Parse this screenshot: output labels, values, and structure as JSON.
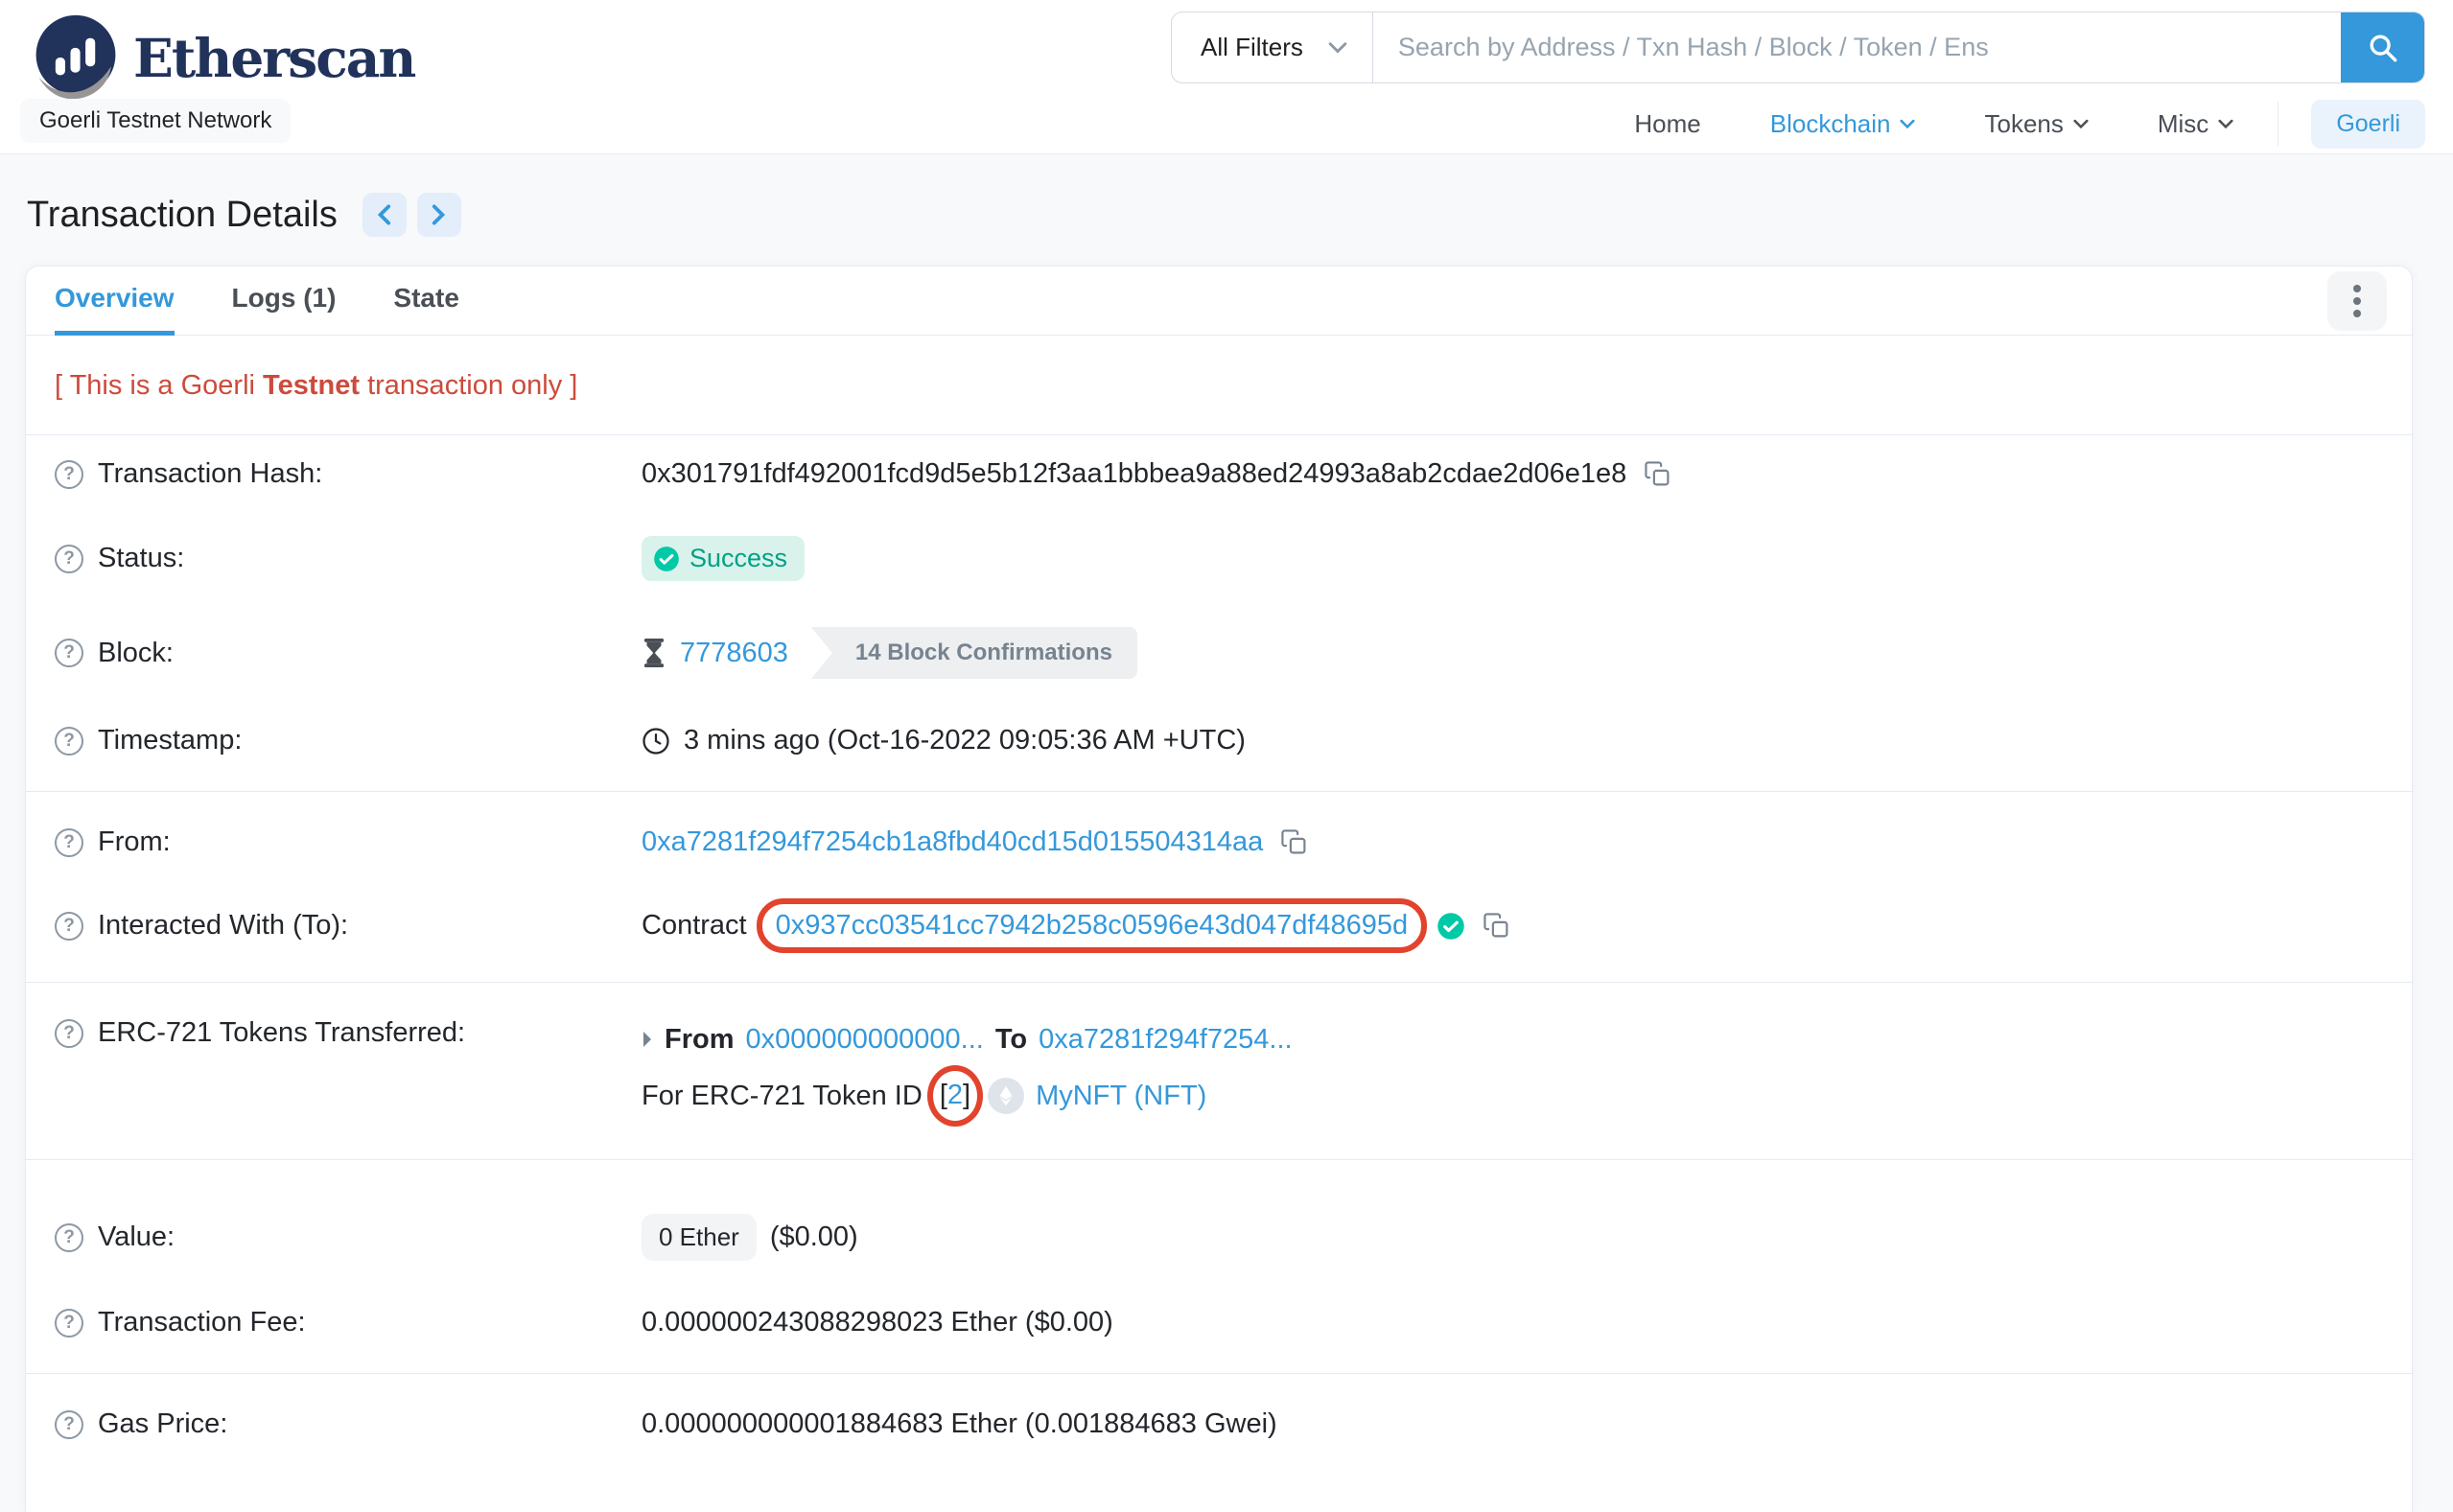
{
  "header": {
    "brand": "Etherscan",
    "network_badge": "Goerli Testnet Network",
    "search": {
      "filter_label": "All Filters",
      "placeholder": "Search by Address / Txn Hash / Block / Token / Ens"
    },
    "nav": {
      "home": "Home",
      "blockchain": "Blockchain",
      "tokens": "Tokens",
      "misc": "Misc",
      "network_button": "Goerli"
    }
  },
  "page": {
    "title": "Transaction Details",
    "tabs": [
      {
        "label": "Overview"
      },
      {
        "label": "Logs (1)"
      },
      {
        "label": "State"
      }
    ],
    "notice": {
      "prefix": "[ This is a Goerli ",
      "bold": "Testnet",
      "suffix": " transaction only ]"
    }
  },
  "rows": {
    "transaction_hash": {
      "label": "Transaction Hash:",
      "value": "0x301791fdf492001fcd9d5e5b12f3aa1bbbea9a88ed24993a8ab2cdae2d06e1e8"
    },
    "status": {
      "label": "Status:",
      "value": "Success"
    },
    "block": {
      "label": "Block:",
      "number": "7778603",
      "confirmations": "14 Block Confirmations"
    },
    "timestamp": {
      "label": "Timestamp:",
      "value": "3 mins ago (Oct-16-2022 09:05:36 AM +UTC)"
    },
    "from": {
      "label": "From:",
      "address": "0xa7281f294f7254cb1a8fbd40cd15d015504314aa"
    },
    "interacted": {
      "label": "Interacted With (To):",
      "prefix": "Contract",
      "address": "0x937cc03541cc7942b258c0596e43d047df48695d"
    },
    "erc721": {
      "label": "ERC-721 Tokens Transferred:",
      "from_label": "From",
      "from_address": "0x000000000000...",
      "to_label": "To",
      "to_address": "0xa7281f294f7254...",
      "line2_prefix": "For ERC-721 Token ID",
      "bracket_open": "[",
      "token_id": "2",
      "bracket_close": "]",
      "token_name": "MyNFT (NFT)"
    },
    "value": {
      "label": "Value:",
      "badge": "0 Ether",
      "usd": "($0.00)"
    },
    "fee": {
      "label": "Transaction Fee:",
      "value": "0.000000243088298023 Ether ($0.00)"
    },
    "gas_price": {
      "label": "Gas Price:",
      "value": "0.000000000001884683 Ether (0.001884683 Gwei)"
    }
  },
  "icons": {
    "search": "magnifier",
    "help": "question-mark-circle",
    "copy": "copy-overlapping-squares",
    "success_check": "check-circle-green",
    "hourglass": "hourglass",
    "clock": "clock-outline",
    "verified_check": "check-circle-green",
    "caret": "right-triangle",
    "token": "ethereum-diamond-in-circle",
    "kebab": "vertical-three-dots"
  },
  "colors": {
    "link": "#3498db",
    "brand": "#21325b",
    "success_text": "#00a186",
    "success_bg": "#d9f3ec",
    "danger_text": "#cc4b3c",
    "annotation_red": "#e2432c",
    "page_bg": "#f8f9fa",
    "border": "#e7eaf3"
  }
}
